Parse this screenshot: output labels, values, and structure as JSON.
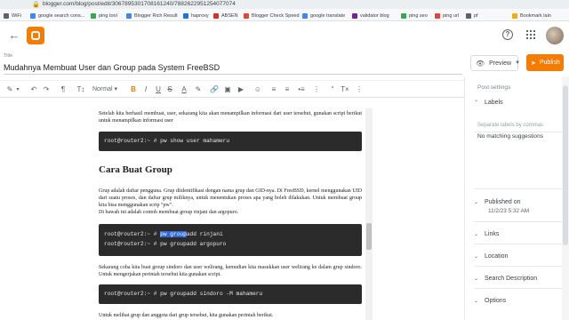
{
  "browser": {
    "url": "blogger.com/blog/post/edit/3067895301708161240/7882622951254077074",
    "bookmarks": [
      {
        "label": "WiFi",
        "color": "#5f6368"
      },
      {
        "label": "google search cons...",
        "color": "#4285f4"
      },
      {
        "label": "ping tool",
        "color": "#34a853"
      },
      {
        "label": "Blogger Rich Result",
        "color": "#4285f4"
      },
      {
        "label": "haproxy",
        "color": "#1a73e8"
      },
      {
        "label": "ABSEN",
        "color": "#d93025"
      },
      {
        "label": "Blogger Check Speed",
        "color": "#ea4335"
      },
      {
        "label": "google translate",
        "color": "#4285f4"
      },
      {
        "label": "validator blog",
        "color": "#7b1fa2"
      },
      {
        "label": "ping seo",
        "color": "#34a853"
      },
      {
        "label": "ping url",
        "color": "#ea4335"
      },
      {
        "label": "pf",
        "color": "#5f6368"
      },
      {
        "label": "Bookmark lain",
        "color": "#f9ab00"
      }
    ]
  },
  "post": {
    "title_label": "Title",
    "title": "Mudahnya Membuat User dan Group pada System FreeBSD"
  },
  "actions": {
    "preview": "Preview",
    "publish": "Publish"
  },
  "toolbar": {
    "font_size_label": "Normal"
  },
  "content": {
    "para1": "Setelah kita berhasil membuat, user, sekarang kita akan menampilkan informasi dari user tersebut, gunakan script berikut untuk menampilkan informasi user",
    "code1": [
      "root@router2:~ # pw show user mahameru"
    ],
    "heading": "Cara Buat Group",
    "para2": "Grup adalah daftar pengguna. Grup diidentifikasi dengan nama grup dan GID-nya. Di FreeBSD, kernel menggunakan UID dari suatu proses, dan daftar grup miliknya, untuk menentukan proses apa yang boleh dilakukan. Untuk membuat group kita bisa menggunakan scrip \"pw\".",
    "para2b": "Di bawah ini adalah contoh membuat group rinjani dan argopuro.",
    "code2": [
      {
        "prompt": "root@router2:~ # ",
        "hl": "pw group",
        "rest": "add rinjani"
      },
      {
        "prompt": "root@router2:~ # ",
        "hl": "",
        "rest": "pw groupadd argopuro"
      }
    ],
    "para3": "Sekarang coba kita buat group sindoro dan user welirang, kemudian kita masukkan user welirang ke dalam grup sindoro. Untuk mengerjakan perintah tersebut kita gunakan script.",
    "code3": [
      "root@router2:~ # pw groupadd sindoro -M mahameru"
    ],
    "para4": "Untuk melihat grup dan anggota dari grup tersebut, kita gunakan perintah berikut."
  },
  "sidebar": {
    "post_settings": "Post settings",
    "labels": "Labels",
    "labels_placeholder": "Separate labels by commas",
    "no_suggestions": "No matching suggestions",
    "published_on": "Published on",
    "published_date": "11/2/23 5:32 AM",
    "links": "Links",
    "location": "Location",
    "search_description": "Search Description",
    "options": "Options"
  }
}
